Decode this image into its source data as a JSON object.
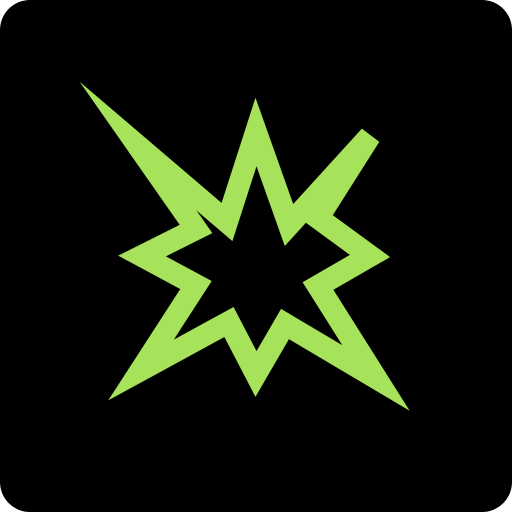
{
  "icon": {
    "name": "eight-pointed-star-logo",
    "background_color": "#000000",
    "accent_color": "#A6E35A"
  }
}
